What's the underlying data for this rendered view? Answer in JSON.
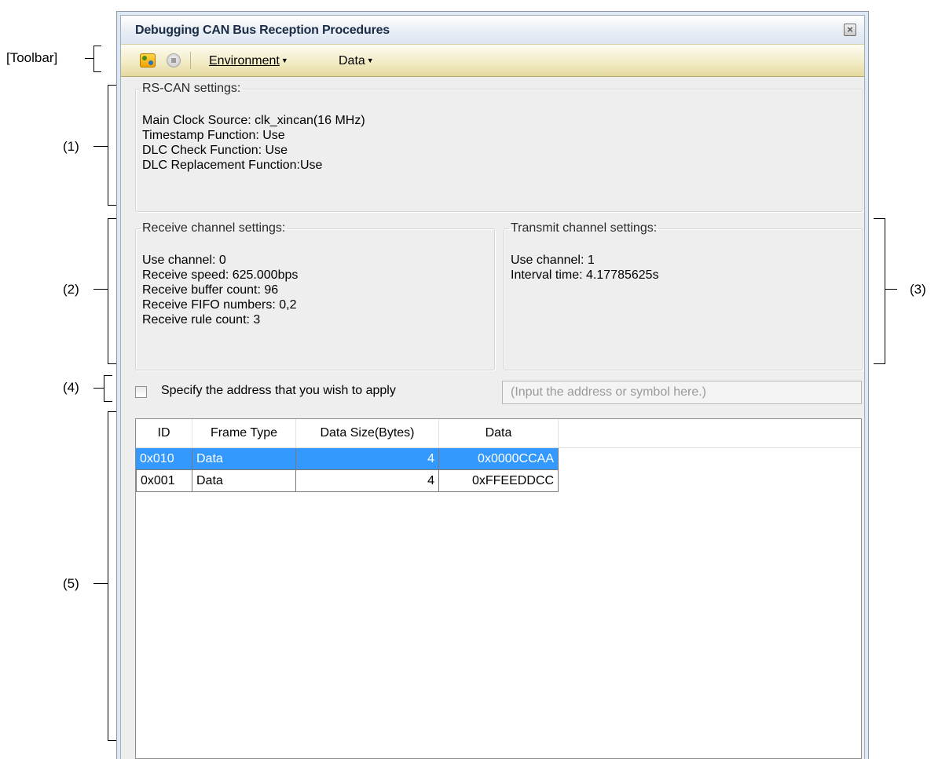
{
  "callouts": {
    "toolbar": "[Toolbar]",
    "c1": "(1)",
    "c2": "(2)",
    "c3": "(3)",
    "c4": "(4)",
    "c5": "(5)"
  },
  "window": {
    "title": "Debugging CAN Bus Reception Procedures",
    "close_glyph": "×"
  },
  "toolbar": {
    "run_icon": "can-debug-icon",
    "stop_icon": "stop-icon",
    "environment_label": "Environment",
    "data_label": "Data",
    "dropdown_glyph": "▼"
  },
  "rscan": {
    "legend": "RS-CAN settings:",
    "lines": [
      "Main Clock Source: clk_xincan(16 MHz)",
      "Timestamp Function: Use",
      "DLC Check Function: Use",
      "DLC Replacement Function:Use"
    ]
  },
  "receive": {
    "legend": "Receive channel settings:",
    "lines": [
      "Use channel: 0",
      "Receive speed: 625.000bps",
      "Receive buffer count: 96",
      "Receive FIFO numbers: 0,2",
      "Receive rule count: 3"
    ]
  },
  "transmit": {
    "legend": "Transmit channel settings:",
    "lines": [
      "Use channel: 1",
      "Interval time: 4.17785625s"
    ]
  },
  "address": {
    "checkbox_label": "Specify the address that you wish to apply",
    "checked": false,
    "input_value": "",
    "input_placeholder": "(Input the address or symbol here.)"
  },
  "table": {
    "columns": [
      "ID",
      "Frame Type",
      "Data Size(Bytes)",
      "Data"
    ],
    "rows": [
      {
        "id": "0x010",
        "frame_type": "Data",
        "size": "4",
        "data": "0x0000CCAA",
        "selected": true
      },
      {
        "id": "0x001",
        "frame_type": "Data",
        "size": "4",
        "data": "0xFFEEDDCC",
        "selected": false
      }
    ]
  },
  "colors": {
    "selection": "#3399ff",
    "toolbar_bg": "#f2ecc6",
    "window_frame": "#dfe9f5"
  }
}
